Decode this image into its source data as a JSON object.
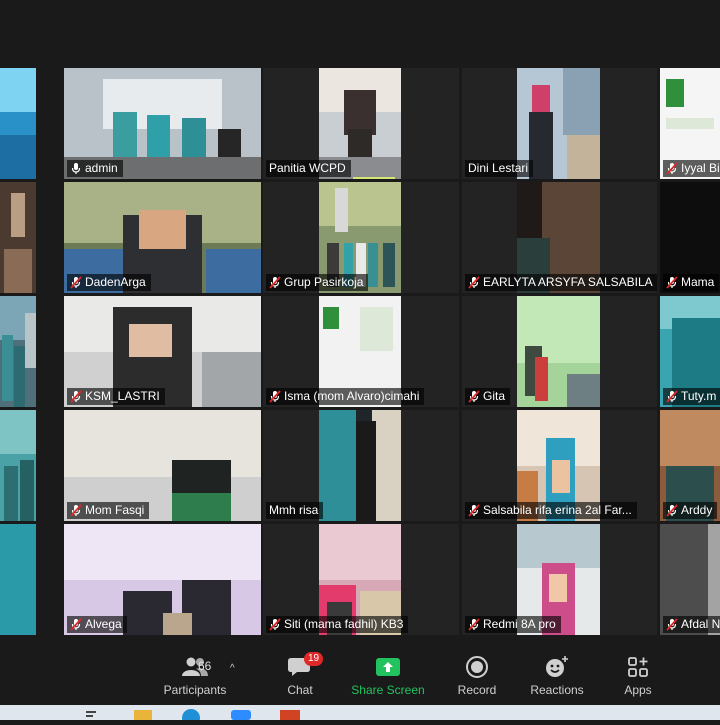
{
  "participants": [
    {
      "name": "",
      "muted": false,
      "scene": "blue"
    },
    {
      "name": "admin",
      "muted": false,
      "active": true,
      "scene": "stage"
    },
    {
      "name": "Panitia WCPD",
      "muted": false,
      "scene": "seated"
    },
    {
      "name": "Dini Lestari",
      "muted": false,
      "scene": "hijab-pink"
    },
    {
      "name": "Iyyal Bi",
      "muted": true,
      "scene": "slide"
    },
    {
      "name": "",
      "muted": false,
      "scene": "room"
    },
    {
      "name": "DadenArga",
      "muted": true,
      "scene": "boy"
    },
    {
      "name": "Grup Pasirkoja",
      "muted": true,
      "scene": "group"
    },
    {
      "name": "EARLYTA ARSYFA SALSABILA",
      "muted": true,
      "scene": "dark-curtain"
    },
    {
      "name": "Mama",
      "muted": true,
      "scene": "dark"
    },
    {
      "name": "",
      "muted": false,
      "scene": "family"
    },
    {
      "name": "KSM_LASTRI",
      "muted": true,
      "scene": "woman-glasses"
    },
    {
      "name": "Isma (mom Alvaro)cimahi",
      "muted": true,
      "scene": "slide2"
    },
    {
      "name": "Gita",
      "muted": true,
      "scene": "green-wall"
    },
    {
      "name": "Tuty.m",
      "muted": true,
      "scene": "teal"
    },
    {
      "name": "",
      "muted": false,
      "scene": "teal-room"
    },
    {
      "name": "Mom Fasqi",
      "muted": true,
      "scene": "hijab-green"
    },
    {
      "name": "Mmh risa",
      "muted": false,
      "scene": "door"
    },
    {
      "name": "Salsabila rifa erina  2al Far...",
      "muted": true,
      "scene": "child"
    },
    {
      "name": "Arddy",
      "muted": true,
      "scene": "warm"
    },
    {
      "name": "",
      "muted": false,
      "scene": "edge"
    },
    {
      "name": "Alvega",
      "muted": true,
      "scene": "pink-room"
    },
    {
      "name": "Siti (mama fadhil) KB3",
      "muted": true,
      "scene": "baby"
    },
    {
      "name": "Redmi 8A pro",
      "muted": true,
      "scene": "girl-pink"
    },
    {
      "name": "Afdal N",
      "muted": true,
      "scene": "grey"
    }
  ],
  "toolbar": {
    "participants_label": "Participants",
    "participants_count": "66",
    "chat_label": "Chat",
    "chat_badge": "19",
    "share_label": "Share Screen",
    "record_label": "Record",
    "reactions_label": "Reactions",
    "apps_label": "Apps"
  },
  "colors": {
    "background": "#1a1a1a",
    "active_speaker": "#d6e676",
    "share_green": "#22c35e",
    "muted_red": "#e02828"
  }
}
